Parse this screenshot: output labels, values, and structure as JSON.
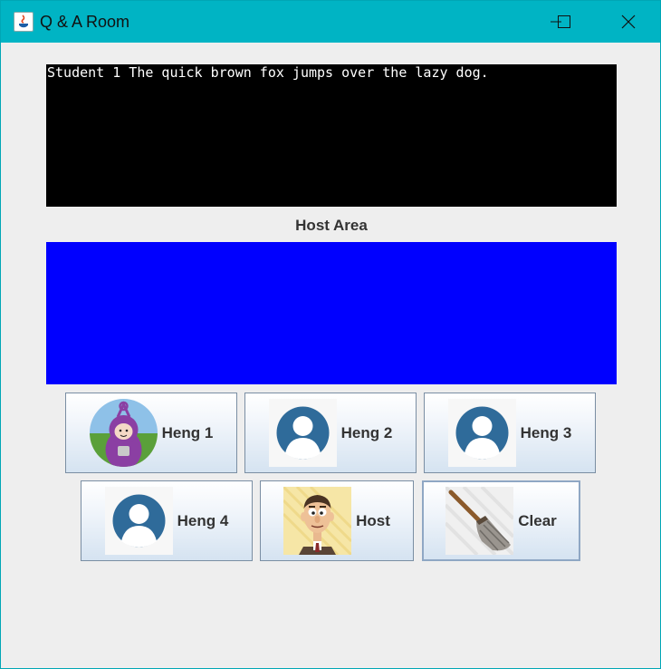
{
  "window": {
    "title": "Q & A Room",
    "controls": [
      "minimize",
      "maximize",
      "close"
    ]
  },
  "console": {
    "text": "Student 1 The quick brown fox jumps over the lazy dog."
  },
  "host_area": {
    "label": "Host Area",
    "color": "#0000ff"
  },
  "buttons": [
    {
      "label": "Heng 1",
      "icon": "teletubby-avatar-icon"
    },
    {
      "label": "Heng 2",
      "icon": "user-avatar-icon"
    },
    {
      "label": "Heng 3",
      "icon": "user-avatar-icon"
    },
    {
      "label": "Heng 4",
      "icon": "user-avatar-icon"
    },
    {
      "label": "Host",
      "icon": "cartoon-man-avatar-icon"
    },
    {
      "label": "Clear",
      "icon": "broom-icon"
    }
  ],
  "colors": {
    "titlebar": "#00b4c4",
    "console_bg": "#000000",
    "avatar_blue": "#2f6b9a"
  }
}
